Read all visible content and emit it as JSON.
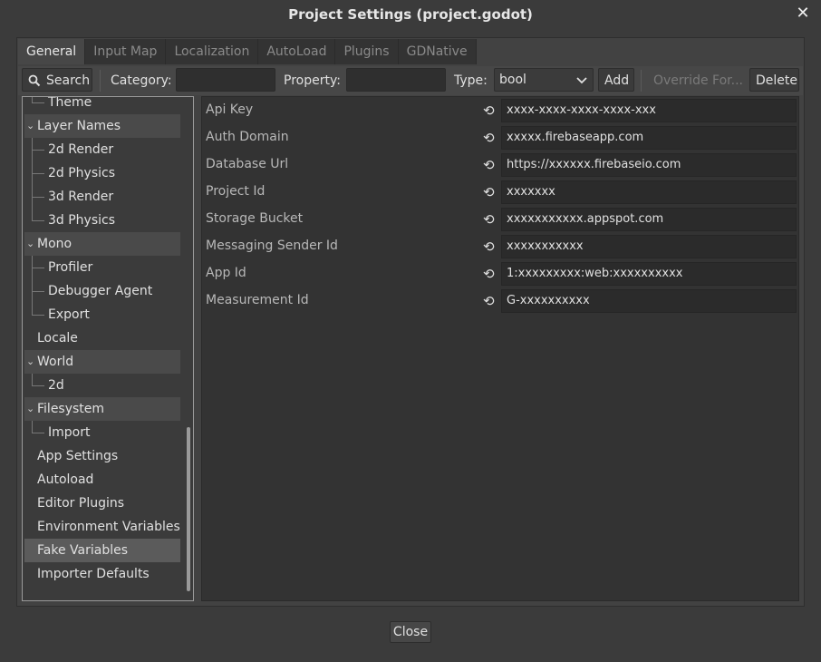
{
  "window": {
    "title": "Project Settings (project.godot)",
    "close_glyph": "✕"
  },
  "tabs": [
    {
      "label": "General",
      "active": true
    },
    {
      "label": "Input Map"
    },
    {
      "label": "Localization"
    },
    {
      "label": "AutoLoad"
    },
    {
      "label": "Plugins"
    },
    {
      "label": "GDNative"
    }
  ],
  "toolbar": {
    "search_label": "Search",
    "category_label": "Category:",
    "category_value": "",
    "property_label": "Property:",
    "property_value": "",
    "type_label": "Type:",
    "type_value": "bool",
    "add_label": "Add",
    "override_label": "Override For...",
    "delete_label": "Delete"
  },
  "tree": [
    {
      "label": "Theme",
      "kind": "child-end"
    },
    {
      "label": "Layer Names",
      "kind": "cat"
    },
    {
      "label": "2d Render",
      "kind": "child"
    },
    {
      "label": "2d Physics",
      "kind": "child"
    },
    {
      "label": "3d Render",
      "kind": "child"
    },
    {
      "label": "3d Physics",
      "kind": "child-end"
    },
    {
      "label": "Mono",
      "kind": "cat"
    },
    {
      "label": "Profiler",
      "kind": "child"
    },
    {
      "label": "Debugger Agent",
      "kind": "child"
    },
    {
      "label": "Export",
      "kind": "child-end"
    },
    {
      "label": "Locale",
      "kind": "top"
    },
    {
      "label": "World",
      "kind": "cat"
    },
    {
      "label": "2d",
      "kind": "child-end"
    },
    {
      "label": "Filesystem",
      "kind": "cat"
    },
    {
      "label": "Import",
      "kind": "child-end"
    },
    {
      "label": "App Settings",
      "kind": "top"
    },
    {
      "label": "Autoload",
      "kind": "top"
    },
    {
      "label": "Editor Plugins",
      "kind": "top"
    },
    {
      "label": "Environment Variables",
      "kind": "top"
    },
    {
      "label": "Fake Variables",
      "kind": "sel"
    },
    {
      "label": "Importer Defaults",
      "kind": "top"
    }
  ],
  "properties": [
    {
      "name": "Api Key",
      "value": "xxxx-xxxx-xxxx-xxxx-xxx"
    },
    {
      "name": "Auth Domain",
      "value": "xxxxx.firebaseapp.com"
    },
    {
      "name": "Database Url",
      "value": "https://xxxxxx.firebaseio.com"
    },
    {
      "name": "Project Id",
      "value": "xxxxxxx"
    },
    {
      "name": "Storage Bucket",
      "value": "xxxxxxxxxxx.appspot.com"
    },
    {
      "name": "Messaging Sender Id",
      "value": "xxxxxxxxxxx"
    },
    {
      "name": "App Id",
      "value": "1:xxxxxxxxx:web:xxxxxxxxxx"
    },
    {
      "name": "Measurement Id",
      "value": "G-xxxxxxxxxx"
    }
  ],
  "footer": {
    "close_label": "Close"
  }
}
